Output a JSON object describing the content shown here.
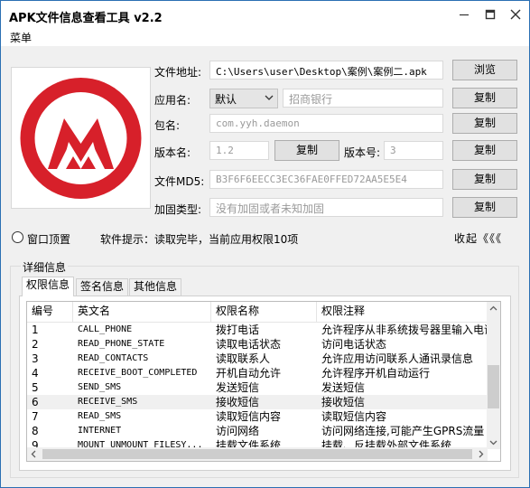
{
  "window": {
    "title": "APK文件信息查看工具 v2.2"
  },
  "menu": {
    "items": [
      "菜单"
    ]
  },
  "form": {
    "file_path_label": "文件地址:",
    "file_path_value": "C:\\Users\\user\\Desktop\\案例\\案例二.apk",
    "browse_label": "浏览",
    "app_name_label": "应用名:",
    "lang_select_value": "默认",
    "app_name_value": "招商银行",
    "copy_label": "复制",
    "package_label": "包名:",
    "package_value": "com.yyh.daemon",
    "version_name_label": "版本名:",
    "version_name_value": "1.2",
    "version_code_label": "版本号:",
    "version_code_value": "3",
    "md5_label": "文件MD5:",
    "md5_value": "B3F6F6EECC3EC36FAE0FFED72AA5E5E4",
    "protect_label": "加固类型:",
    "protect_value": "没有加固或者未知加固"
  },
  "status": {
    "topmost_label": "窗口顶置",
    "hint": "软件提示：读取完毕，当前应用权限10项",
    "collapse_label": "收起《《《"
  },
  "details": {
    "group_title": "详细信息",
    "tabs": [
      "权限信息",
      "签名信息",
      "其他信息"
    ],
    "columns": [
      "编号",
      "英文名",
      "权限名称",
      "权限注释"
    ],
    "rows": [
      [
        "1",
        "CALL_PHONE",
        "拨打电话",
        "允许程序从非系统拨号器里输入电话"
      ],
      [
        "2",
        "READ_PHONE_STATE",
        "读取电话状态",
        "访问电话状态"
      ],
      [
        "3",
        "READ_CONTACTS",
        "读取联系人",
        "允许应用访问联系人通讯录信息"
      ],
      [
        "4",
        "RECEIVE_BOOT_COMPLETED",
        "开机自动允许",
        "允许程序开机自动运行"
      ],
      [
        "5",
        "SEND_SMS",
        "发送短信",
        "发送短信"
      ],
      [
        "6",
        "RECEIVE_SMS",
        "接收短信",
        "接收短信"
      ],
      [
        "7",
        "READ_SMS",
        "读取短信内容",
        "读取短信内容"
      ],
      [
        "8",
        "INTERNET",
        "访问网络",
        "访问网络连接,可能产生GPRS流量"
      ],
      [
        "9",
        "MOUNT_UNMOUNT_FILESY...",
        "挂载文件系统",
        "挂载、反挂载外部文件系统"
      ]
    ],
    "selected_row": 6
  },
  "colors": {
    "logo_red": "#d7202a",
    "window_border": "#2b6fb3"
  },
  "icons": [
    "minimize-icon",
    "maximize-icon",
    "close-icon",
    "chevron-down-icon",
    "app-logo-icon"
  ]
}
